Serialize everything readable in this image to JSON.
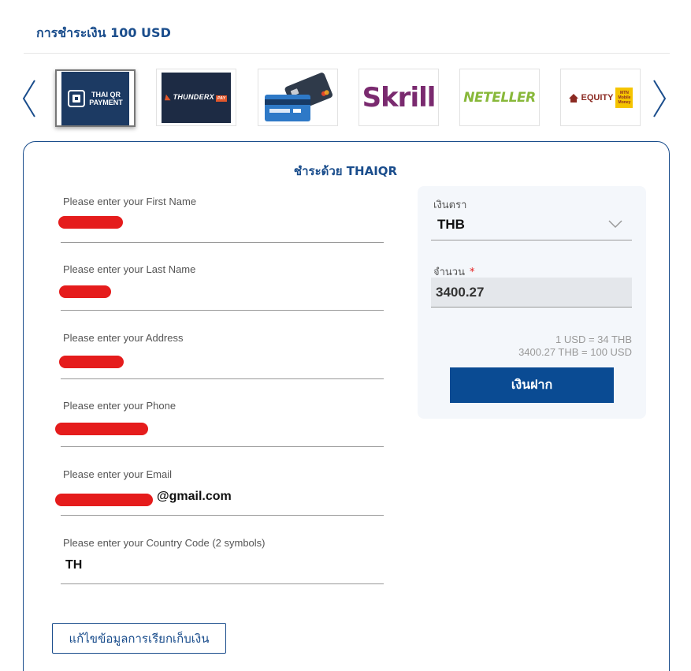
{
  "page": {
    "title": "การชำระเงิน 100 USD"
  },
  "payment_methods": [
    {
      "name": "Thai QR Payment",
      "logo_lines": [
        "THAI QR",
        "PAYMENT"
      ],
      "selected": true
    },
    {
      "name": "ThunderX Pay",
      "logo_text": "THUNDERX",
      "logo_tag": "PAY",
      "selected": false
    },
    {
      "name": "Bank Card",
      "selected": false
    },
    {
      "name": "Skrill",
      "logo_text": "Skrill",
      "selected": false
    },
    {
      "name": "Neteller",
      "logo_text": "NETELLER",
      "selected": false
    },
    {
      "name": "Equity / MTN Mobile Money",
      "logo_text": "EQUITY",
      "badge_text": "MTN Mobile Money",
      "selected": false
    }
  ],
  "form": {
    "title": "ชำระด้วย THAIQR",
    "fields": [
      {
        "label": "Please enter your First Name",
        "value": ""
      },
      {
        "label": "Please enter your Last Name",
        "value": ""
      },
      {
        "label": "Please enter your Address",
        "value": ""
      },
      {
        "label": "Please enter your Phone",
        "value": ""
      },
      {
        "label": "Please enter your Email",
        "value": "@gmail.com"
      },
      {
        "label": "Please enter your Country Code (2 symbols)",
        "value": "TH"
      }
    ],
    "edit_billing_label": "แก้ไขข้อมูลการเรียกเก็บเงิน"
  },
  "deposit": {
    "currency_label": "เงินตรา",
    "currency_value": "THB",
    "amount_label": "จำนวน",
    "required_mark": "*",
    "amount_value": "3400.27",
    "rate_line_1": "1 USD = 34 THB",
    "rate_line_2": "3400.27 THB = 100 USD",
    "button_label": "เงินฝาก"
  },
  "colors": {
    "brand": "#1a4d8c",
    "button": "#0a4b93",
    "redaction": "#e51c1c"
  }
}
